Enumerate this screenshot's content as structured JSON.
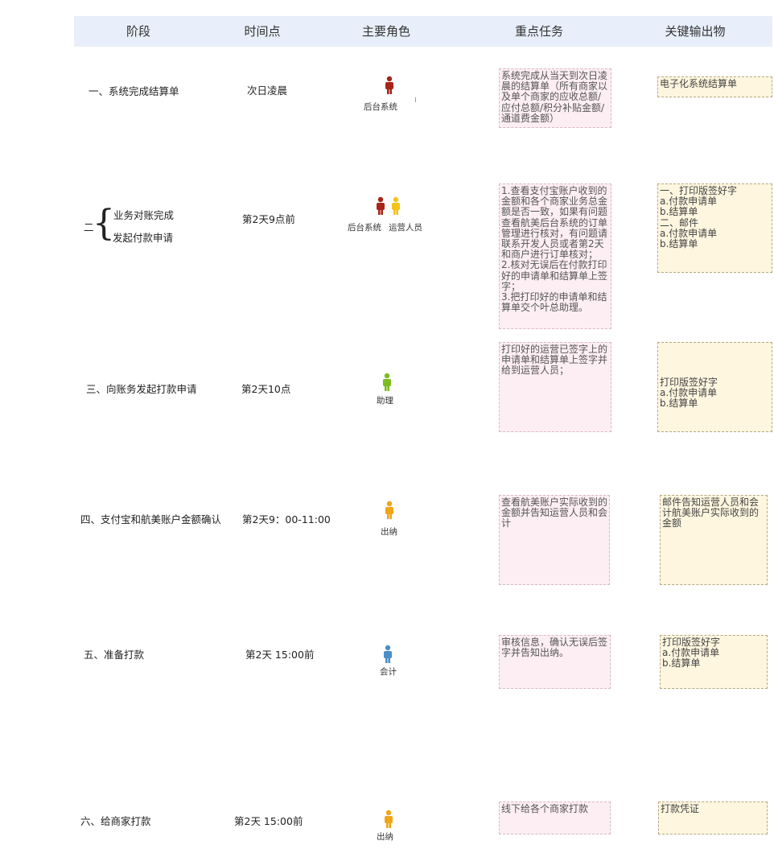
{
  "header": {
    "stage": "阶段",
    "time": "时间点",
    "role": "主要角色",
    "task": "重点任务",
    "output": "关键输出物"
  },
  "rows": [
    {
      "stage": "一、系统完成结算单",
      "time": "次日凌晨",
      "roles": [
        "后台系统"
      ],
      "task": "系统完成从当天到次日凌晨的结算单（所有商家以及单个商家的应收总额/应付总额/积分补贴金额/通道费金额）",
      "output": "电子化系统结算单"
    },
    {
      "stage_prefix": "二",
      "stage_lines": [
        "业务对账完成",
        "发起付款申请"
      ],
      "time": "第2天9点前",
      "roles": [
        "后台系统",
        "运营人员"
      ],
      "task": "1.查看支付宝账户收到的金额和各个商家业务总金额是否一致，如果有问题查看航美后台系统的订单管理进行核对，有问题请联系开发人员或者第2天和商户进行订单核对；\n2.核对无误后在付款打印好的申请单和结算单上签字；\n3.把打印好的申请单和结算单交个叶总助理。",
      "output": "一、打印版签好字\na.付款申请单\nb.结算单\n二、邮件\na.付款申请单\nb.结算单"
    },
    {
      "stage": "三、向账务发起打款申请",
      "time": "第2天10点",
      "roles": [
        "助理"
      ],
      "task": "打印好的运营已签字上的申请单和结算单上签字并给到运营人员；",
      "output": "打印版签好字\na.付款申请单\nb.结算单"
    },
    {
      "stage": "四、支付宝和航美账户金额确认",
      "time": "第2天9：00-11:00",
      "roles": [
        "出纳"
      ],
      "task": "查看航美账户实际收到的金额并告知运营人员和会计",
      "output": "邮件告知运营人员和会计航美账户实际收到的金额"
    },
    {
      "stage": "五、准备打款",
      "time": "第2天 15:00前",
      "roles": [
        "会计"
      ],
      "task": "审核信息，确认无误后签字并告知出纳。",
      "output": "打印版签好字\na.付款申请单\nb.结算单"
    },
    {
      "stage": "六、给商家打款",
      "time": "第2天 15:00前",
      "roles": [
        "出纳"
      ],
      "task": "线下给各个商家打款",
      "output": "打款凭证"
    }
  ],
  "colors": {
    "header_bg": "#e8effa",
    "task_bg": "#fdeef3",
    "output_bg": "#fef6df",
    "person_darkred": "#a82418",
    "person_yellow": "#f2c318",
    "person_green": "#7cbc20",
    "person_orange": "#f0a418",
    "person_blue": "#4a8ec8"
  },
  "icons": [
    "person-icon"
  ]
}
